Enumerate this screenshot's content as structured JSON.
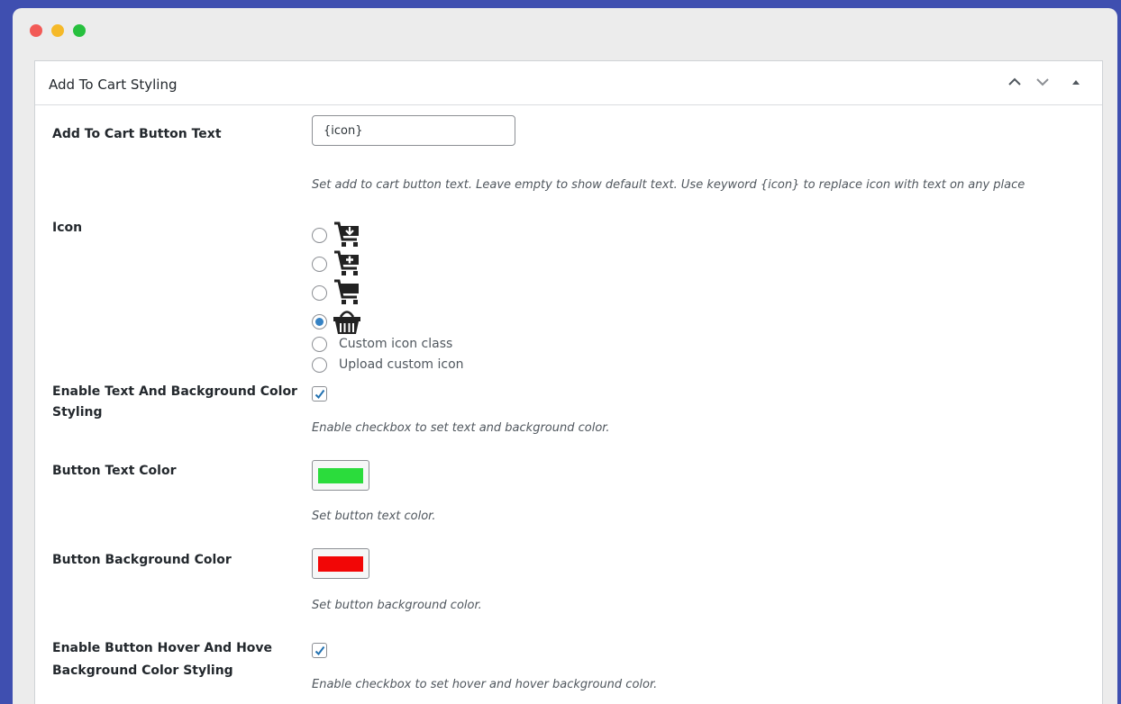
{
  "panel": {
    "title": "Add To Cart Styling"
  },
  "fields": {
    "button_text": {
      "label": "Add To Cart Button Text",
      "value": "{icon}",
      "description": "Set add to cart button text. Leave empty to show default text. Use keyword {icon} to replace icon with text on any place"
    },
    "icon": {
      "label": "Icon",
      "options": [
        {
          "icon": "cart-download-icon",
          "checked": false
        },
        {
          "icon": "cart-plus-icon",
          "checked": false
        },
        {
          "icon": "cart-icon",
          "checked": false
        },
        {
          "icon": "basket-icon",
          "checked": true
        },
        {
          "label": "Custom icon class",
          "checked": false
        },
        {
          "label": "Upload custom icon",
          "checked": false
        }
      ]
    },
    "enable_color": {
      "label_line1": "Enable Text And Background Color",
      "label_line2": "Styling",
      "checked": true,
      "description": "Enable checkbox to set text and background color."
    },
    "text_color": {
      "label": "Button Text Color",
      "color": "#2bdc3c",
      "description": "Set button text color."
    },
    "bg_color": {
      "label": "Button Background Color",
      "color": "#f20606",
      "description": "Set button background color."
    },
    "enable_hover": {
      "label_line1": "Enable Button Hover And Hove",
      "label_line2": "Background Color Styling",
      "checked": true,
      "description": "Enable checkbox to set hover and hover background color."
    }
  },
  "colors": {
    "accent": "#3582c4"
  }
}
